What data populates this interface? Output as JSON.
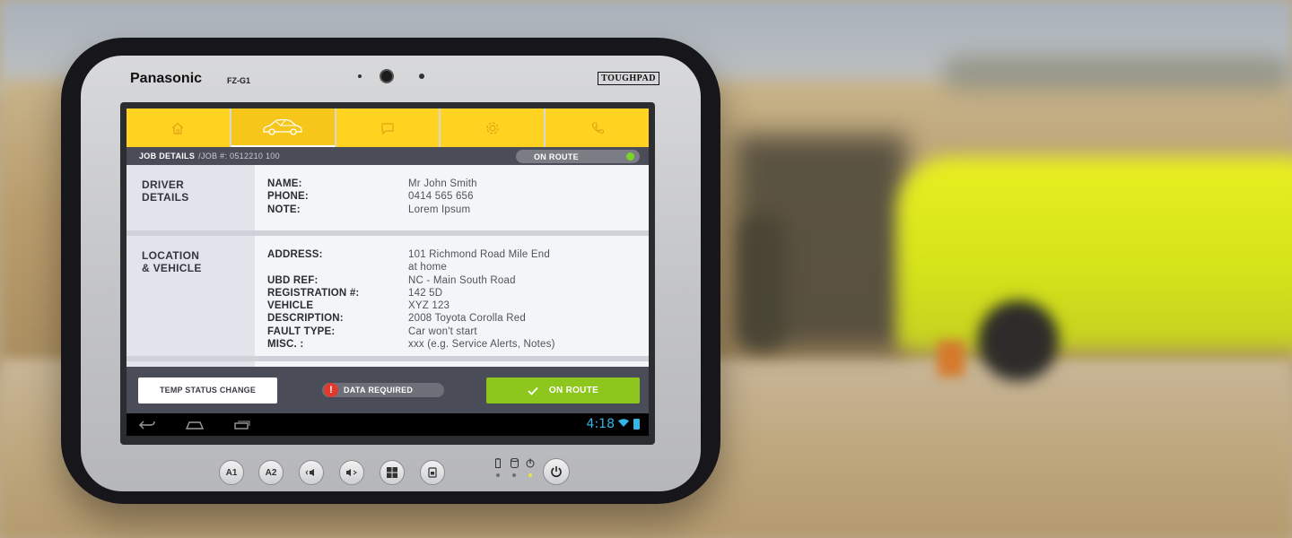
{
  "device": {
    "brand": "Panasonic",
    "model": "FZ-G1",
    "badge": "TOUGHPAD"
  },
  "nav_tabs": [
    {
      "icon": "home-icon",
      "active": false
    },
    {
      "icon": "car-icon",
      "active": true
    },
    {
      "icon": "chat-icon",
      "active": false
    },
    {
      "icon": "gear-icon",
      "active": false
    },
    {
      "icon": "phone-icon",
      "active": false
    }
  ],
  "breadcrumb": {
    "title": "JOB DETAILS",
    "sub": "/JOB #: 0512210 100"
  },
  "status_toggle": {
    "label": "ON ROUTE",
    "indicator_color": "#78d62a"
  },
  "driver": {
    "title_line1": "DRIVER",
    "title_line2": "DETAILS",
    "rows": [
      {
        "label": "NAME:",
        "value": "Mr John Smith"
      },
      {
        "label": "PHONE:",
        "value": "0414 565 656"
      },
      {
        "label": "NOTE:",
        "value": "Lorem Ipsum"
      }
    ]
  },
  "location": {
    "title_line1": "LOCATION",
    "title_line2": "& VEHICLE",
    "rows": [
      {
        "label": "ADDRESS:",
        "value": "101 Richmond  Road  Mile End"
      },
      {
        "label": "",
        "value": "at home"
      },
      {
        "label": "UBD REF:",
        "value": "NC - Main South Road"
      },
      {
        "label": "REGISTRATION #:",
        "value": "142 5D"
      },
      {
        "label": "VEHICLE",
        "value": "XYZ 123"
      },
      {
        "label": "DESCRIPTION:",
        "value": "2008 Toyota Corolla Red"
      },
      {
        "label": "FAULT TYPE:",
        "value": "Car won't start"
      },
      {
        "label": "MISC. :",
        "value": "xxx (e.g. Service Alerts, Notes)"
      }
    ]
  },
  "actions": {
    "temp_status": "TEMP STATUS CHANGE",
    "data_required": "DATA REQUIRED",
    "data_required_mark": "!",
    "on_route": "ON ROUTE"
  },
  "system_bar": {
    "time": "4:18"
  },
  "hardware_buttons": [
    "A1",
    "A2"
  ],
  "colors": {
    "accent_yellow": "#ffd320",
    "bar_dark": "#4a4c57",
    "green": "#8dc71d",
    "alert_red": "#e03a2f",
    "clock_blue": "#33b5e5"
  }
}
